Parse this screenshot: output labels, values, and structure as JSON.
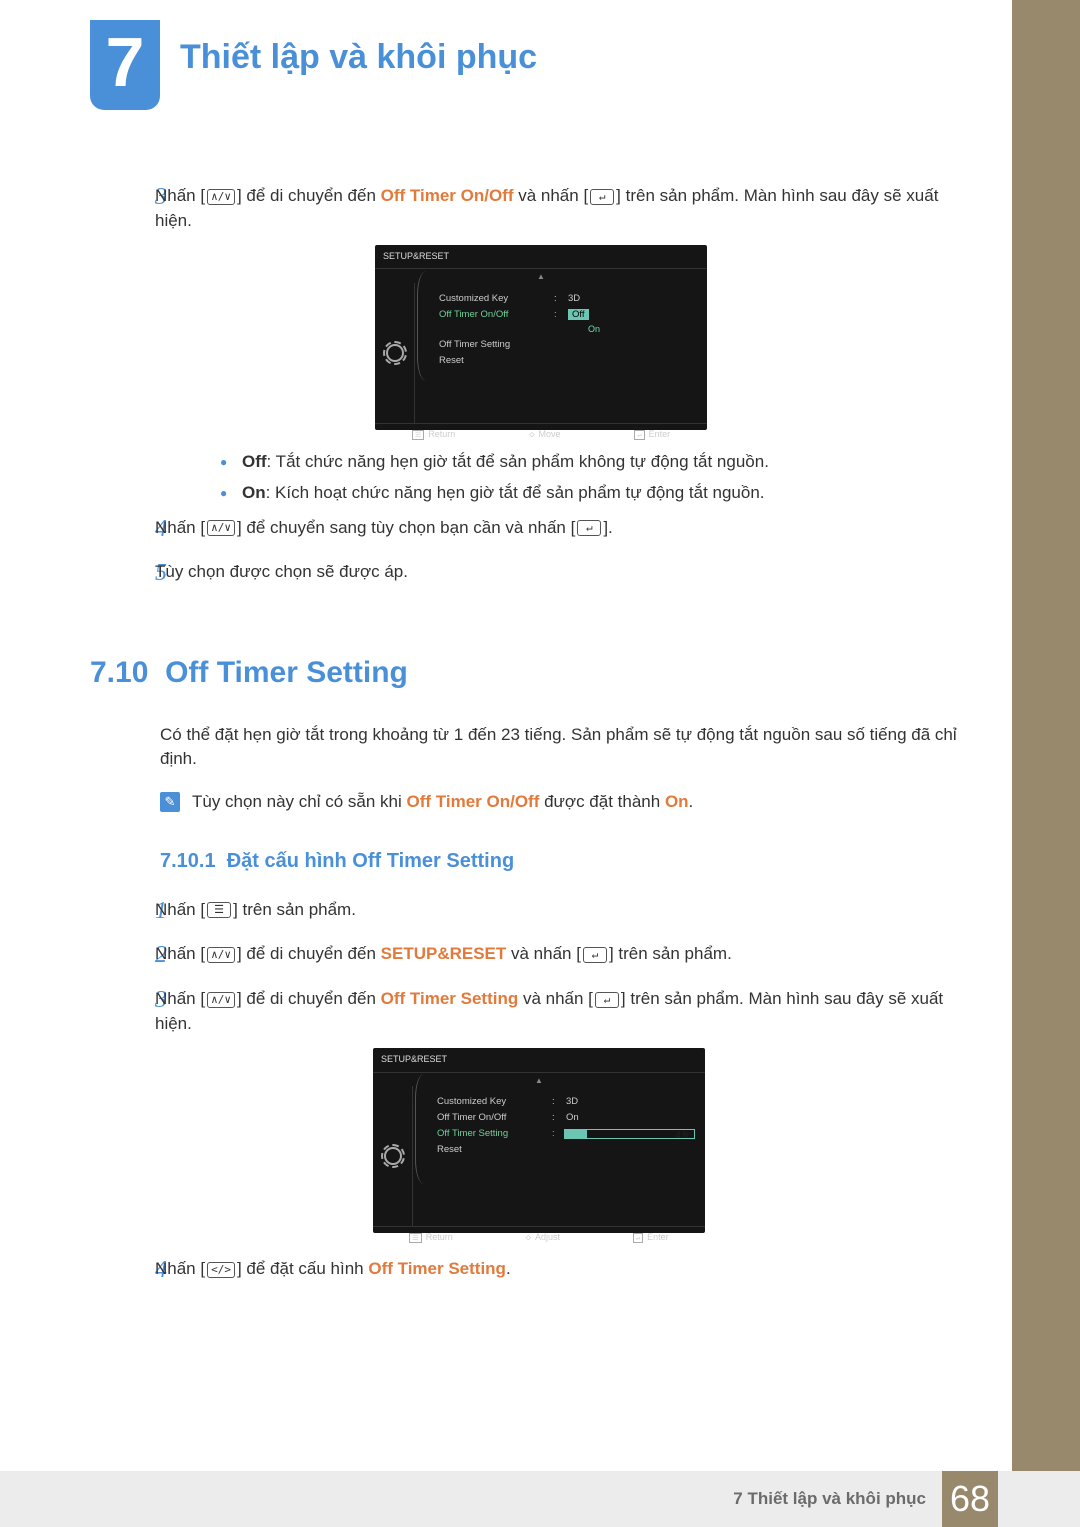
{
  "chapter": {
    "number": "7",
    "title": "Thiết lập và khôi phục"
  },
  "steps_top": {
    "s3": {
      "num": "3",
      "pre": "Nhấn [",
      "mid1": "] để di chuyển đến ",
      "key": "Off Timer On/Off",
      "mid2": " và nhấn [",
      "post": "] trên sản phẩm. Màn hình sau đây sẽ xuất hiện."
    },
    "b_off": {
      "label": "Off",
      "text": ": Tắt chức năng hẹn giờ tắt để sản phẩm không tự động tắt nguồn."
    },
    "b_on": {
      "label": "On",
      "text": ": Kích hoạt chức năng hẹn giờ tắt để sản phẩm tự động tắt nguồn."
    },
    "s4": {
      "num": "4",
      "pre": "Nhấn [",
      "mid": "] để chuyển sang tùy chọn bạn cần và nhấn [",
      "post": "]."
    },
    "s5": {
      "num": "5",
      "text": "Tùy chọn được chọn sẽ được áp."
    }
  },
  "osd1": {
    "header": "SETUP&RESET",
    "rows": [
      {
        "label": "Customized Key",
        "val": "3D"
      },
      {
        "label": "Off Timer On/Off",
        "val": "Off",
        "highlight": true,
        "pill": true
      },
      {
        "label": "Off Timer Setting",
        "val": ""
      },
      {
        "label": "Reset",
        "val": ""
      }
    ],
    "on_below": "On",
    "footer": {
      "return": "Return",
      "move": "Move",
      "enter": "Enter"
    }
  },
  "section710": {
    "num": "7.10",
    "title": "Off Timer Setting",
    "desc": "Có thể đặt hẹn giờ tắt trong khoảng từ 1 đến 23 tiếng. Sản phẩm sẽ tự động tắt nguồn sau số tiếng đã chỉ định.",
    "note_pre": "Tùy chọn này chỉ có sẵn khi ",
    "note_key": "Off Timer On/Off",
    "note_mid": " được đặt thành ",
    "note_val": "On",
    "note_end": "."
  },
  "section7101": {
    "num": "7.10.1",
    "title": "Đặt cấu hình Off Timer Setting",
    "s1": {
      "num": "1",
      "pre": "Nhấn [",
      "post": "] trên sản phẩm."
    },
    "s2": {
      "num": "2",
      "pre": "Nhấn [",
      "mid": "] để di chuyển đến ",
      "key": "SETUP&RESET",
      "mid2": " và nhấn [",
      "post": "] trên sản phẩm."
    },
    "s3": {
      "num": "3",
      "pre": "Nhấn [",
      "mid": "] để di chuyển đến ",
      "key": "Off Timer Setting",
      "mid2": " và nhấn [",
      "post": "] trên sản phẩm. Màn hình sau đây sẽ xuất hiện."
    },
    "s4": {
      "num": "4",
      "pre": "Nhấn [",
      "mid": "] để đặt cấu hình ",
      "key": "Off Timer Setting",
      "post": "."
    }
  },
  "osd2": {
    "header": "SETUP&RESET",
    "rows": [
      {
        "label": "Customized Key",
        "val": "3D"
      },
      {
        "label": "Off Timer On/Off",
        "val": "On"
      },
      {
        "label": "Off Timer Setting",
        "slider": "4 h",
        "highlight": true
      },
      {
        "label": "Reset",
        "val": ""
      }
    ],
    "footer": {
      "return": "Return",
      "move": "Adjust",
      "enter": "Enter"
    }
  },
  "footer": {
    "text": "7 Thiết lập và khôi phục",
    "page": "68"
  }
}
